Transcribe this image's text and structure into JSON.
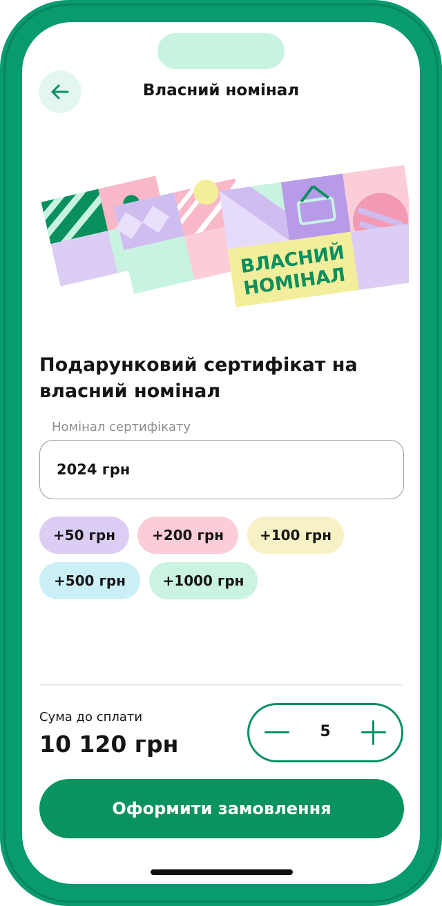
{
  "header": {
    "title": "Власний номінал"
  },
  "illustration": {
    "card_text_line1": "ВЛАСНИЙ",
    "card_text_line2": "НОМІНАЛ"
  },
  "product": {
    "title": "Подарунковий сертифікат на власний номінал"
  },
  "amount_field": {
    "label": "Номінал сертифікату",
    "value": "2024 грн"
  },
  "chips": [
    {
      "label": "+50 грн",
      "color": "#dccdf5"
    },
    {
      "label": "+200 грн",
      "color": "#fbcdd6"
    },
    {
      "label": "+100 грн",
      "color": "#f6f2c6"
    },
    {
      "label": "+500 грн",
      "color": "#cbeff7"
    },
    {
      "label": "+1000 грн",
      "color": "#caf3e0"
    }
  ],
  "summary": {
    "label": "Сума до сплати",
    "value": "10 120 грн"
  },
  "quantity": {
    "value": "5"
  },
  "order_button": {
    "label": "Оформити замовлення"
  },
  "colors": {
    "brand": "#0a9a70",
    "button": "#09935f",
    "accent_light": "#e4f7ef"
  }
}
